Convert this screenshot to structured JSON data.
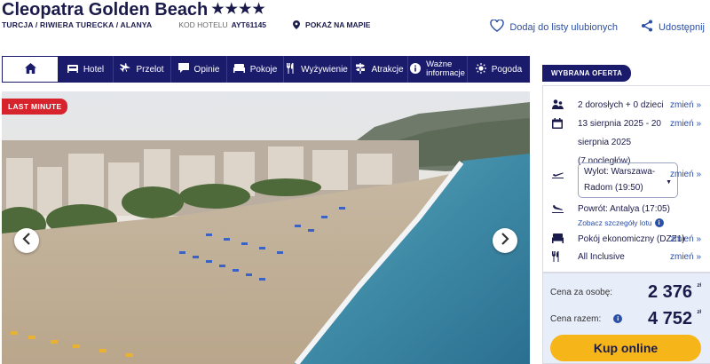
{
  "hotel": {
    "name": "Cleopatra Golden Beach",
    "stars": "★★★★",
    "location": "TURCJA / RIWIERA TURECKA / ALANYA",
    "code_label": "KOD HOTELU",
    "code_value": "AYT61145",
    "map_link": "POKAŻ NA MAPIE"
  },
  "actions": {
    "favorite": "Dodaj do listy ulubionych",
    "share": "Udostępnij"
  },
  "nav": {
    "tabs": [
      {
        "label": "Hotel",
        "icon": "bed-icon"
      },
      {
        "label": "Przelot",
        "icon": "plane-icon"
      },
      {
        "label": "Opinie",
        "icon": "speech-bubble-icon"
      },
      {
        "label": "Pokoje",
        "icon": "bed-icon"
      },
      {
        "label": "Wyżywienie",
        "icon": "cutlery-icon"
      },
      {
        "label": "Atrakcje",
        "icon": "signpost-icon"
      },
      {
        "label": "Ważne informacje",
        "line1": "Ważne",
        "line2": "informacje",
        "icon": "info-icon"
      },
      {
        "label": "Pogoda",
        "icon": "sun-icon"
      }
    ]
  },
  "gallery": {
    "badge": "LAST MINUTE"
  },
  "offer": {
    "title": "WYBRANA OFERTA",
    "change_label": "zmień »",
    "guests": "2 dorosłych + 0 dzieci",
    "dates_line1": "13 sierpnia 2025 - 20",
    "dates_line2": "sierpnia 2025",
    "nights": "(7 nocległów)",
    "departure_line1": "Wylot: Warszawa-",
    "departure_line2": "Radom (19:50)",
    "return": "Powrót: Antalya (17:05)",
    "flight_details": "Zobacz szczegóły lotu",
    "room": "Pokój ekonomiczny (DZZ1)",
    "board": "All Inclusive"
  },
  "price": {
    "per_person_label": "Cena za osobę:",
    "per_person_value": "2 376",
    "total_label": "Cena razem:",
    "total_value": "4 752",
    "currency": "zł",
    "book_button": "Kup online"
  },
  "colors": {
    "navy": "#1b1b6b",
    "link": "#2a4fa8",
    "badge_red": "#d6232c",
    "cta_yellow": "#f6b61a",
    "price_bg": "#e8eef9"
  }
}
